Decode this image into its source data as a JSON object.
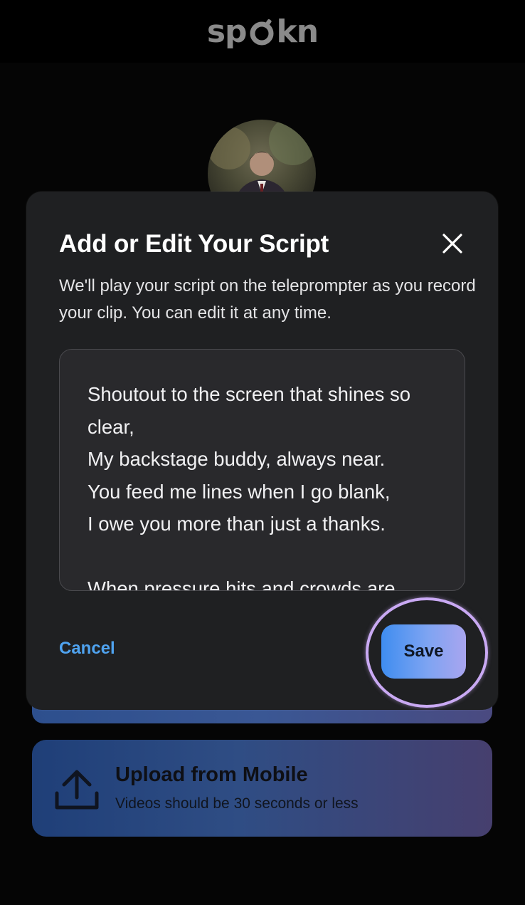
{
  "brand": {
    "logo_text_left": "sp",
    "logo_text_right": "kn"
  },
  "modal": {
    "title": "Add or Edit Your Script",
    "description": "We'll play your script on the teleprompter as you record your clip. You can edit it at any time.",
    "script_value": "Shoutout to the screen that shines so clear,\nMy backstage buddy, always near.\nYou feed me lines when I go blank,\nI owe you more than just a thanks.\n\nWhen pressure hits and crowds are",
    "cancel_label": "Cancel",
    "save_label": "Save"
  },
  "upload": {
    "title": "Upload from Mobile",
    "subtitle": "Videos should be 30 seconds or less"
  },
  "icons": {
    "close": "close-icon",
    "upload": "upload-icon",
    "logo_mark": "spokn-logo-mark-icon",
    "avatar": "profile-photo"
  },
  "colors": {
    "accent_blue": "#4fa3f0",
    "highlight_ring": "#c9a9f3",
    "modal_bg": "#1f2022"
  }
}
